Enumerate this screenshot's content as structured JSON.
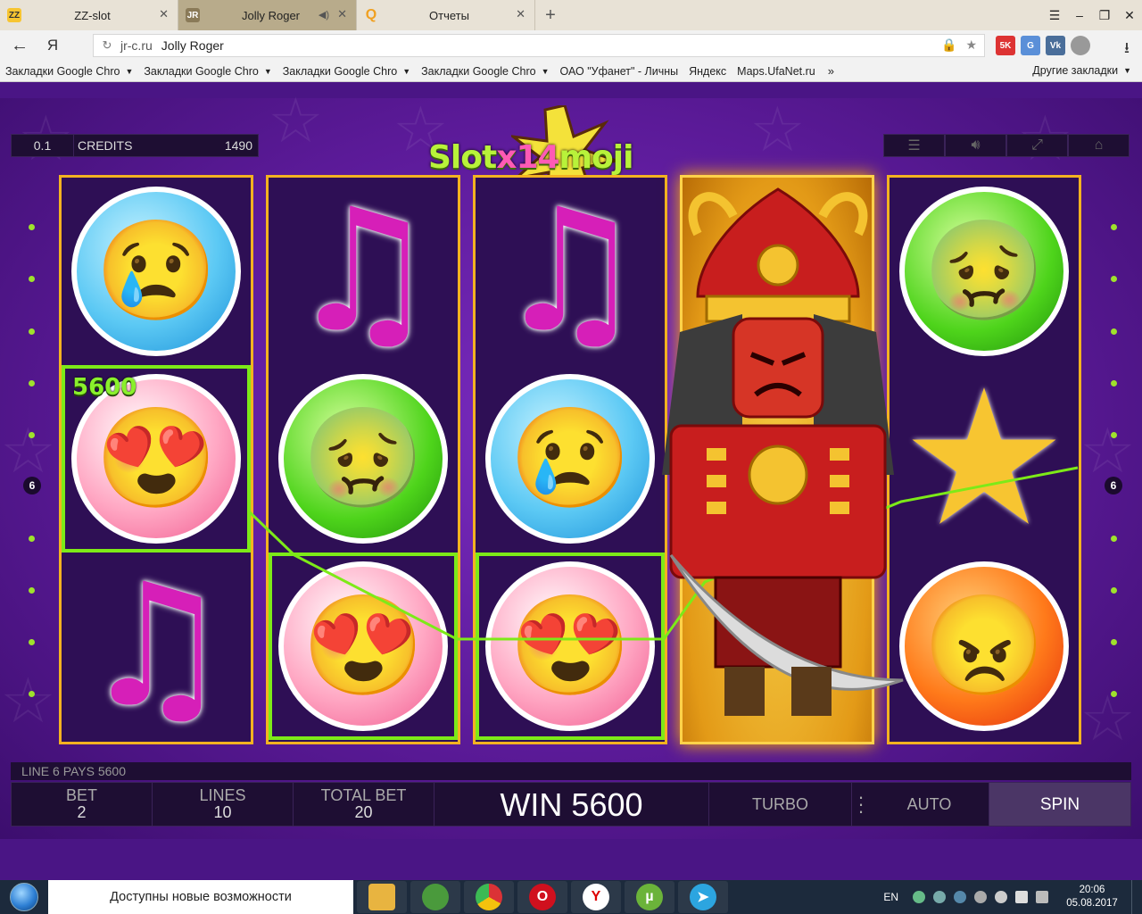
{
  "browser": {
    "tabs": [
      {
        "label": "ZZ-slot",
        "favicon": "ZZ"
      },
      {
        "label": "Jolly Roger",
        "favicon": "JR"
      },
      {
        "label": "Отчеты",
        "favicon": "Q"
      }
    ],
    "new_tab": "+",
    "address": {
      "host": "jr-c.ru",
      "page_title": "Jolly Roger"
    },
    "extensions": [
      "5K",
      "G",
      "Vk"
    ],
    "bookmarks": [
      "Закладки Google Chro",
      "Закладки Google Chro",
      "Закладки Google Chro",
      "Закладки Google Chro",
      "ОАО \"Уфанет\" - Личны",
      "Яндекс",
      "Maps.UfaNet.ru"
    ],
    "bookmarks_more": "»",
    "other_bookmarks": "Другие закладки"
  },
  "game": {
    "denomination": "0.1",
    "credits_label": "CREDITS",
    "credits_value": "1490",
    "logo": {
      "left": "Slot",
      "mid": "x14",
      "right": "moji"
    },
    "line_left": "6",
    "line_right": "6",
    "win_symbol_value": "5600",
    "reels": [
      [
        "sad-blue",
        "love-pink",
        "music-note"
      ],
      [
        "music-note",
        "sick-green",
        "love-pink"
      ],
      [
        "music-note",
        "sad-blue",
        "love-pink"
      ],
      [
        "samurai-wild"
      ],
      [
        "sick-green",
        "star",
        "angry-red"
      ]
    ],
    "status_text": "LINE 6 PAYS 5600",
    "bet_label": "BET",
    "bet_value": "2",
    "lines_label": "LINES",
    "lines_value": "10",
    "total_label": "TOTAL BET",
    "total_value": "20",
    "win_text": "WIN 5600",
    "turbo": "TURBO",
    "auto": "AUTO",
    "spin": "SPIN"
  },
  "taskbar": {
    "notification": "Доступны новые возможности",
    "lang": "EN",
    "time": "20:06",
    "date": "05.08.2017",
    "apps": [
      "explorer-icon",
      "globe-icon",
      "chrome-icon",
      "opera-icon",
      "yandex-icon",
      "utorrent-icon",
      "telegram-icon"
    ]
  },
  "colors": {
    "reel_border": "#f3b221",
    "win_line": "#7dea18",
    "bg_purple": "#5b1a98"
  }
}
